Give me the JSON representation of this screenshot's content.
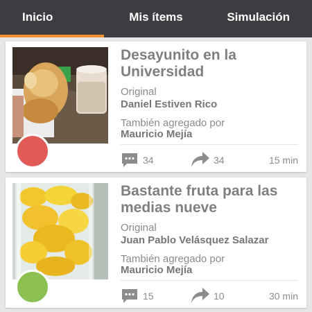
{
  "tabs": [
    {
      "label": "Inicio"
    },
    {
      "label": "Mis ítems"
    },
    {
      "label": "Simulación"
    }
  ],
  "accent_color": "#f08f33",
  "posts": [
    {
      "title": "Desayunito en la Universidad",
      "original_label": "Original",
      "original_author": "Daniel Estiven Rico",
      "also_added_label": "También agregado por",
      "also_added_by": "Mauricio Mejía",
      "comments": "34",
      "shares": "34",
      "time": "15 min",
      "dot_color": "#e25a57",
      "image": "breakfast-pastry-and-drink"
    },
    {
      "title": "Bastante fruta para las medias nueve",
      "original_label": "Original",
      "original_author": "Juan Pablo Velásquez Salazar",
      "also_added_label": "También agregado por",
      "also_added_by": "Mauricio Mejía",
      "comments": "15",
      "shares": "10",
      "time": "30 min",
      "dot_color": "#8cc152",
      "image": "mango-pieces-in-blender"
    }
  ]
}
